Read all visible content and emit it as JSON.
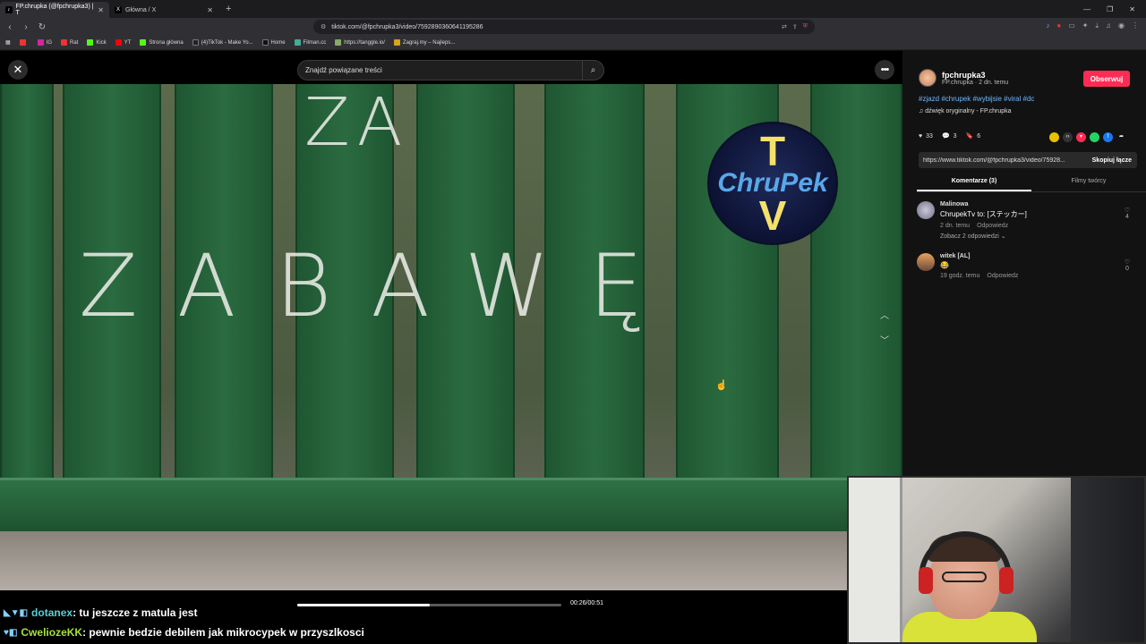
{
  "browser": {
    "tabs": [
      {
        "title": "FP.chrupka (@fpchrupka3) | T",
        "active": true,
        "icon": "tiktok-icon"
      },
      {
        "title": "Główna / X",
        "active": false,
        "icon": "x-icon"
      }
    ],
    "url": "tiktok.com/@fpchrupka3/video/7592890360641195286",
    "bookmarks": [
      {
        "label": "",
        "color": "#e33"
      },
      {
        "label": "IG",
        "color": "#d6249f"
      },
      {
        "label": "Rat",
        "color": "#e33"
      },
      {
        "label": "Kick",
        "color": "#53fc18"
      },
      {
        "label": "YT",
        "color": "#f00"
      },
      {
        "label": "Strona główna",
        "color": "#53fc18"
      },
      {
        "label": "(4)TikTok - Make Yo...",
        "color": "#222"
      },
      {
        "label": "Home",
        "color": "#111"
      },
      {
        "label": "Filman.cc",
        "color": "#4a9"
      },
      {
        "label": "https://tanggle.io/",
        "color": "#8a6"
      },
      {
        "label": "Zagraj.my – Najleps...",
        "color": "#d9a21f"
      }
    ]
  },
  "search": {
    "placeholder": "Znajdź powiązane treści"
  },
  "video": {
    "chalk_top": "ZA",
    "chalk_main": "ZABAWĘ",
    "logo_top": "T",
    "logo_middle": "ChruPek",
    "logo_bottom": "V",
    "time": "00:26/00:51",
    "progress": 0.5
  },
  "chat": [
    {
      "user": "dotanex",
      "message": ": tu jeszcze z matula jest"
    },
    {
      "user": "CweliozeKK",
      "message": ": pewnie bedzie debilem jak mikrocypek w przyszlkosci"
    }
  ],
  "sidebar": {
    "author_name": "fpchrupka3",
    "author_sub": "FP.chrupka · 2 dn. temu",
    "follow_label": "Obserwuj",
    "tags": "#zjazd #chrupek #wybijsie #viral #dc",
    "sound": "♫ dźwięk oryginalny - FP.chrupka",
    "likes": "33",
    "comments": "3",
    "saves": "6",
    "link": "https://www.tiktok.com/@fpchrupka3/video/75928...",
    "copy_label": "Skopiuj łącze",
    "tab_comments": "Komentarze (3)",
    "tab_creator": "Filmy twórcy",
    "comment_list": [
      {
        "user": "Malinowa",
        "text": "ChrupekTv to: [ステッカー]",
        "time": "2 dn. temu",
        "reply": "Odpowiedz",
        "more": "Zobacz 2 odpowiedzi ⌄",
        "likes": "4"
      },
      {
        "user": "witek [AL]",
        "text": "😂",
        "time": "19 godz. temu",
        "reply": "Odpowiedz",
        "likes": "0"
      }
    ]
  }
}
